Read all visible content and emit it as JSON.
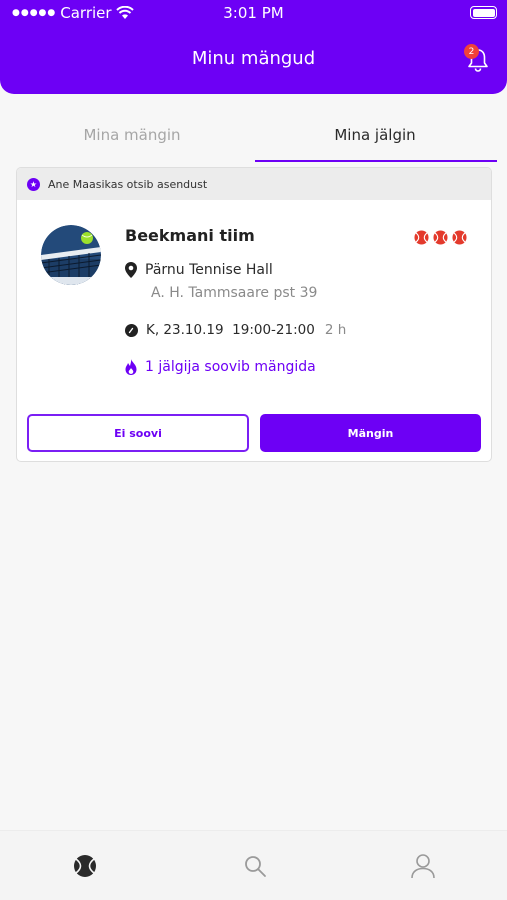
{
  "status_bar": {
    "carrier": "Carrier",
    "time": "3:01 PM"
  },
  "header": {
    "title": "Minu mängud",
    "notification_count": "2"
  },
  "tabs": [
    {
      "label": "Mina mängin",
      "active": false
    },
    {
      "label": "Mina jälgin",
      "active": true
    }
  ],
  "card": {
    "notice_text": "Ane Maasikas otsib asendust",
    "team_name": "Beekmani tiim",
    "level_balls": 3,
    "venue_name": "Pärnu Tennise Hall",
    "venue_address": "A. H. Tammsaare pst 39",
    "datetime": "K, 23.10.19  19:00-21:00",
    "duration": "2 h",
    "followers_text": "1 jälgija soovib mängida",
    "decline_label": "Ei soovi",
    "accept_label": "Mängin"
  },
  "bottom_nav": [
    {
      "icon": "tennis-ball-icon",
      "active": true
    },
    {
      "icon": "search-icon",
      "active": false
    },
    {
      "icon": "profile-icon",
      "active": false
    }
  ],
  "colors": {
    "accent": "#6d00f5",
    "badge": "#f0413a",
    "ball": "#e33a2c"
  }
}
